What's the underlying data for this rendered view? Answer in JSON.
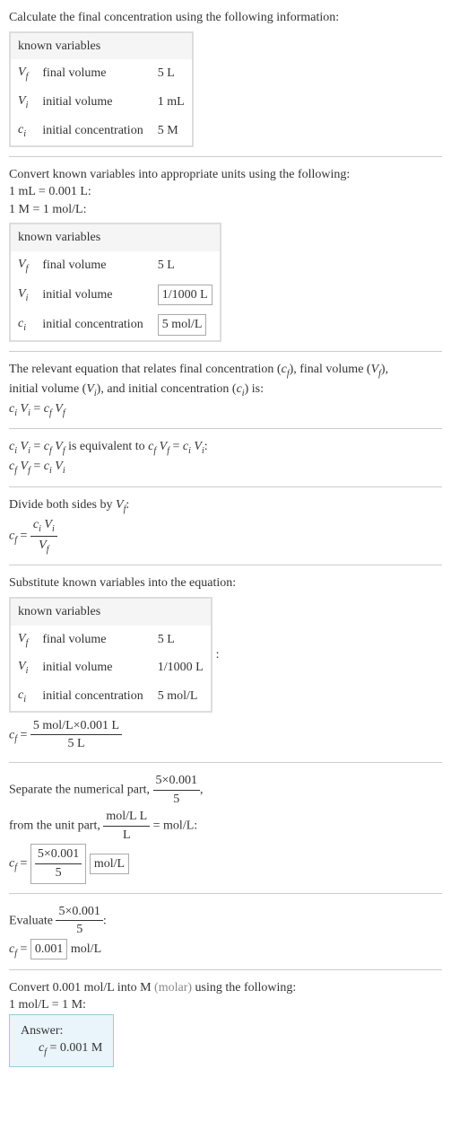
{
  "step1": {
    "intro": "Calculate the final concentration using the following information:",
    "table_header": "known variables",
    "r1c1": "V",
    "r1c1s": "f",
    "r1c2": "final volume",
    "r1c3": "5 L",
    "r2c1": "V",
    "r2c1s": "i",
    "r2c2": "initial volume",
    "r2c3": "1 mL",
    "r3c1": "c",
    "r3c1s": "i",
    "r3c2": "initial concentration",
    "r3c3": "5 M"
  },
  "step2": {
    "line1": "Convert known variables into appropriate units using the following:",
    "line2": "1 mL = 0.001 L:",
    "line3": "1 M = 1 mol/L:",
    "table_header": "known variables",
    "r1c2": "final volume",
    "r1c3": "5 L",
    "r2c2": "initial volume",
    "r2c3": "1/1000 L",
    "r3c2": "initial concentration",
    "r3c3": "5 mol/L"
  },
  "step3": {
    "text_a": "The relevant equation that relates final concentration (",
    "text_b": "), final volume (",
    "text_c": "),",
    "text_d": "initial volume (",
    "text_e": "), and initial concentration (",
    "text_f": ") is:",
    "eq": "c_i V_i = c_f V_f"
  },
  "step4": {
    "text_a": " is equivalent to ",
    "colon": ":"
  },
  "step5": {
    "line1": "Divide both sides by ",
    "colon": ":"
  },
  "step6": {
    "line1": "Substitute known variables into the equation:",
    "table_header": "known variables",
    "r1c2": "final volume",
    "r1c3": "5 L",
    "r2c2": "initial volume",
    "r2c3": "1/1000 L",
    "r3c2": "initial concentration",
    "r3c3": "5 mol/L",
    "colon": ":",
    "num": "5 mol/L×0.001 L",
    "den": "5 L"
  },
  "step7": {
    "line1a": "Separate the numerical part, ",
    "num1": "5×0.001",
    "den1": "5",
    "comma": ",",
    "line2a": "from the unit part, ",
    "num2": "mol/L L",
    "den2": "L",
    "eq_unit": " = mol/L:",
    "res_num": "5×0.001",
    "res_den": "5",
    "res_unit": "mol/L"
  },
  "step8": {
    "line1": "Evaluate ",
    "num": "5×0.001",
    "den": "5",
    "colon": ":",
    "val": "0.001",
    "unit": " mol/L"
  },
  "step9": {
    "line1": "Convert 0.001 mol/L into M ",
    "gray": "(molar)",
    "line1b": " using the following:",
    "line2": "1 mol/L = 1 M:",
    "answer_label": "Answer:",
    "answer_eq": " = 0.001 M"
  }
}
